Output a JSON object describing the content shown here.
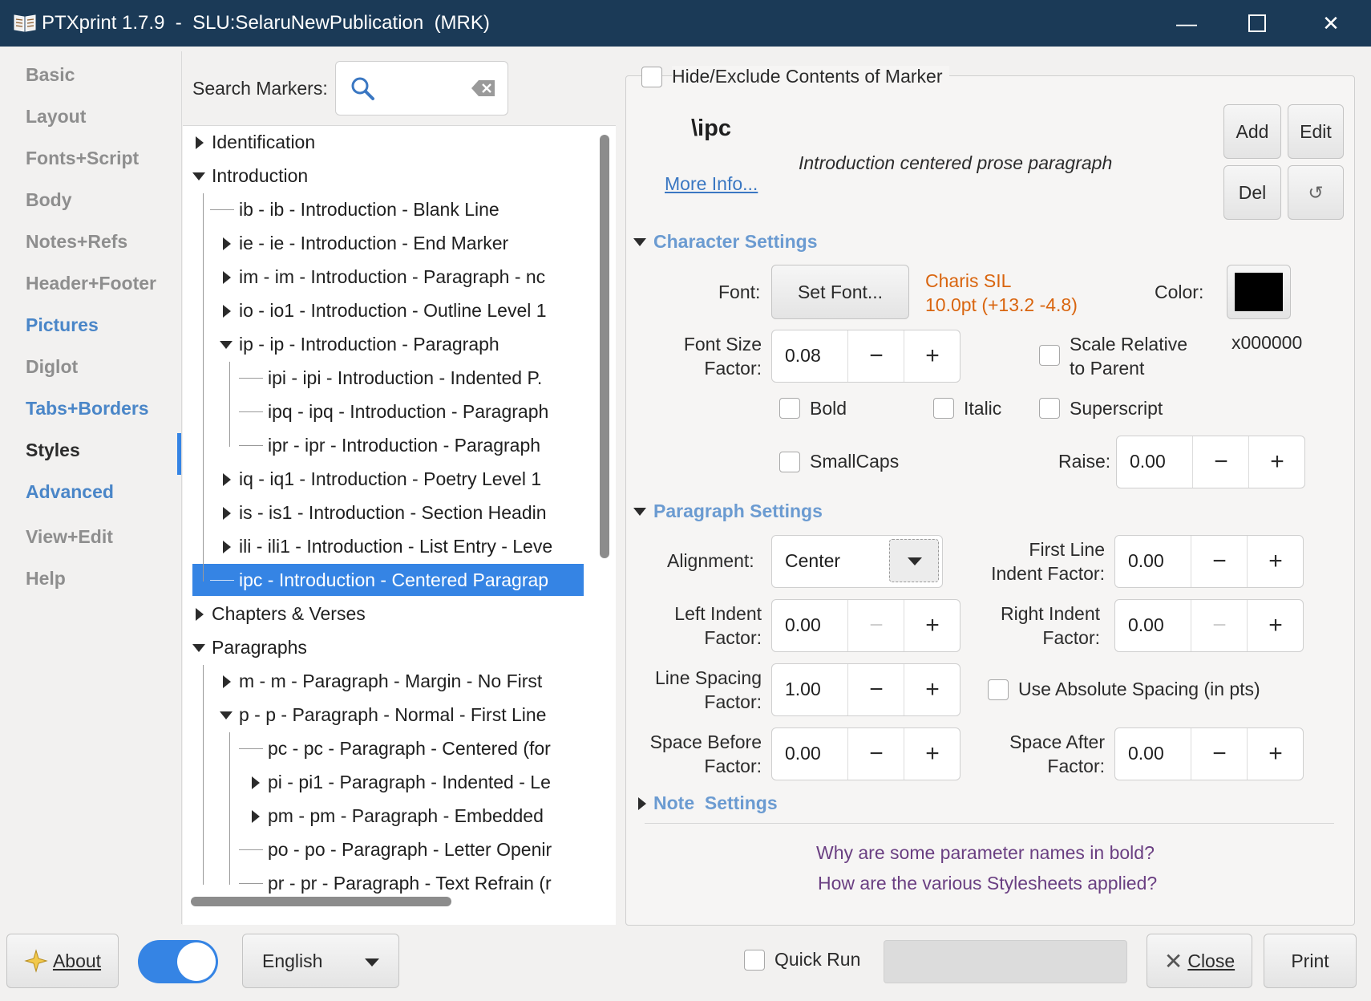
{
  "window": {
    "title": "PTXprint 1.7.9  -  SLU:SelaruNewPublication  (MRK)",
    "icon": "book-icon",
    "minimize": "—",
    "maximize": "☐",
    "close": "✕"
  },
  "sidebar": {
    "items": [
      "Basic",
      "Layout",
      "Fonts+Script",
      "Body",
      "Notes+Refs",
      "Header+Footer",
      "Pictures",
      "Diglot",
      "Tabs+Borders",
      "Styles",
      "Advanced",
      "View+Edit",
      "Help"
    ],
    "active": "Styles"
  },
  "markers": {
    "search_label": "Search Markers:",
    "search_value": "",
    "tree": [
      {
        "level": 0,
        "expander": "right",
        "text": "Identification"
      },
      {
        "level": 0,
        "expander": "down",
        "text": "Introduction"
      },
      {
        "level": 1,
        "expander": "none",
        "text": "ib - ib - Introduction - Blank Line"
      },
      {
        "level": 1,
        "expander": "right",
        "text": "ie - ie - Introduction - End Marker"
      },
      {
        "level": 1,
        "expander": "right",
        "text": "im - im - Introduction - Paragraph - nc"
      },
      {
        "level": 1,
        "expander": "right",
        "text": "io - io1 - Introduction - Outline Level 1"
      },
      {
        "level": 1,
        "expander": "down",
        "text": "ip - ip - Introduction - Paragraph"
      },
      {
        "level": 2,
        "expander": "none",
        "text": "ipi - ipi - Introduction - Indented P."
      },
      {
        "level": 2,
        "expander": "none",
        "text": "ipq - ipq - Introduction - Paragraph"
      },
      {
        "level": 2,
        "expander": "none",
        "text": "ipr - ipr - Introduction - Paragraph"
      },
      {
        "level": 1,
        "expander": "right",
        "text": "iq - iq1 - Introduction - Poetry Level 1"
      },
      {
        "level": 1,
        "expander": "right",
        "text": "is - is1 - Introduction - Section Headin"
      },
      {
        "level": 1,
        "expander": "right",
        "text": "ili - ili1 - Introduction - List Entry - Leve"
      },
      {
        "level": 1,
        "expander": "none",
        "text": "ipc - Introduction - Centered Paragrap",
        "selected": true
      },
      {
        "level": 0,
        "expander": "right",
        "text": "Chapters & Verses"
      },
      {
        "level": 0,
        "expander": "down",
        "text": "Paragraphs"
      },
      {
        "level": 1,
        "expander": "right",
        "text": "m - m - Paragraph - Margin - No First"
      },
      {
        "level": 1,
        "expander": "down",
        "text": "p - p - Paragraph - Normal - First Line"
      },
      {
        "level": 2,
        "expander": "none",
        "text": "pc - pc - Paragraph - Centered (for"
      },
      {
        "level": 2,
        "expander": "right",
        "text": "pi - pi1 - Paragraph - Indented - Le"
      },
      {
        "level": 2,
        "expander": "right",
        "text": "pm - pm - Paragraph - Embedded"
      },
      {
        "level": 2,
        "expander": "none",
        "text": "po - po - Paragraph - Letter Openir"
      },
      {
        "level": 2,
        "expander": "none",
        "text": "pr - pr - Paragraph - Text Refrain (r"
      }
    ]
  },
  "style": {
    "hide_label": "Hide/Exclude Contents of Marker",
    "marker": "\\ipc",
    "description": "Introduction centered prose paragraph",
    "more_info": "More Info...",
    "add": "Add",
    "edit": "Edit",
    "del": "Del",
    "reset": "↺",
    "char_section": "Character Settings",
    "font_label": "Font:",
    "set_font": "Set Font...",
    "font_name": "Charis SIL",
    "font_size_info": "10.0pt (+13.2 -4.8)",
    "color_label": "Color:",
    "color_value": "x000000",
    "color_swatch": "#000000",
    "font_size_label": [
      "Font Size",
      "Factor:"
    ],
    "font_size_value": "0.08",
    "scale_label": [
      "Scale Relative",
      "to Parent"
    ],
    "bold": "Bold",
    "italic": "Italic",
    "superscript": "Superscript",
    "smallcaps": "SmallCaps",
    "raise_label": "Raise:",
    "raise_value": "0.00",
    "para_section": "Paragraph Settings",
    "alignment_label": "Alignment:",
    "alignment_value": "Center",
    "first_line_label": [
      "First Line",
      "Indent Factor:"
    ],
    "first_line_value": "0.00",
    "left_indent_label": [
      "Left Indent",
      "Factor:"
    ],
    "left_indent_value": "0.00",
    "right_indent_label": [
      "Right Indent",
      "Factor:"
    ],
    "right_indent_value": "0.00",
    "line_spacing_label": [
      "Line Spacing",
      "Factor:"
    ],
    "line_spacing_value": "1.00",
    "abs_spacing_label": "Use Absolute Spacing (in pts)",
    "space_before_label": [
      "Space Before",
      "Factor:"
    ],
    "space_before_value": "0.00",
    "space_after_label": [
      "Space After",
      "Factor:"
    ],
    "space_after_value": "0.00",
    "note_section": "Note  Settings",
    "faq1": "Why are some parameter names in bold?",
    "faq2": "How are the various Stylesheets applied?"
  },
  "bottom": {
    "about": "About",
    "language": "English",
    "quick_run": "Quick Run",
    "close": "Close",
    "print": "Print"
  },
  "colors": {
    "titlebar": "#1b3a57",
    "accent": "#3584e4",
    "link": "#4a86c8",
    "font_info": "#d9650f",
    "faq": "#6a3f82"
  }
}
